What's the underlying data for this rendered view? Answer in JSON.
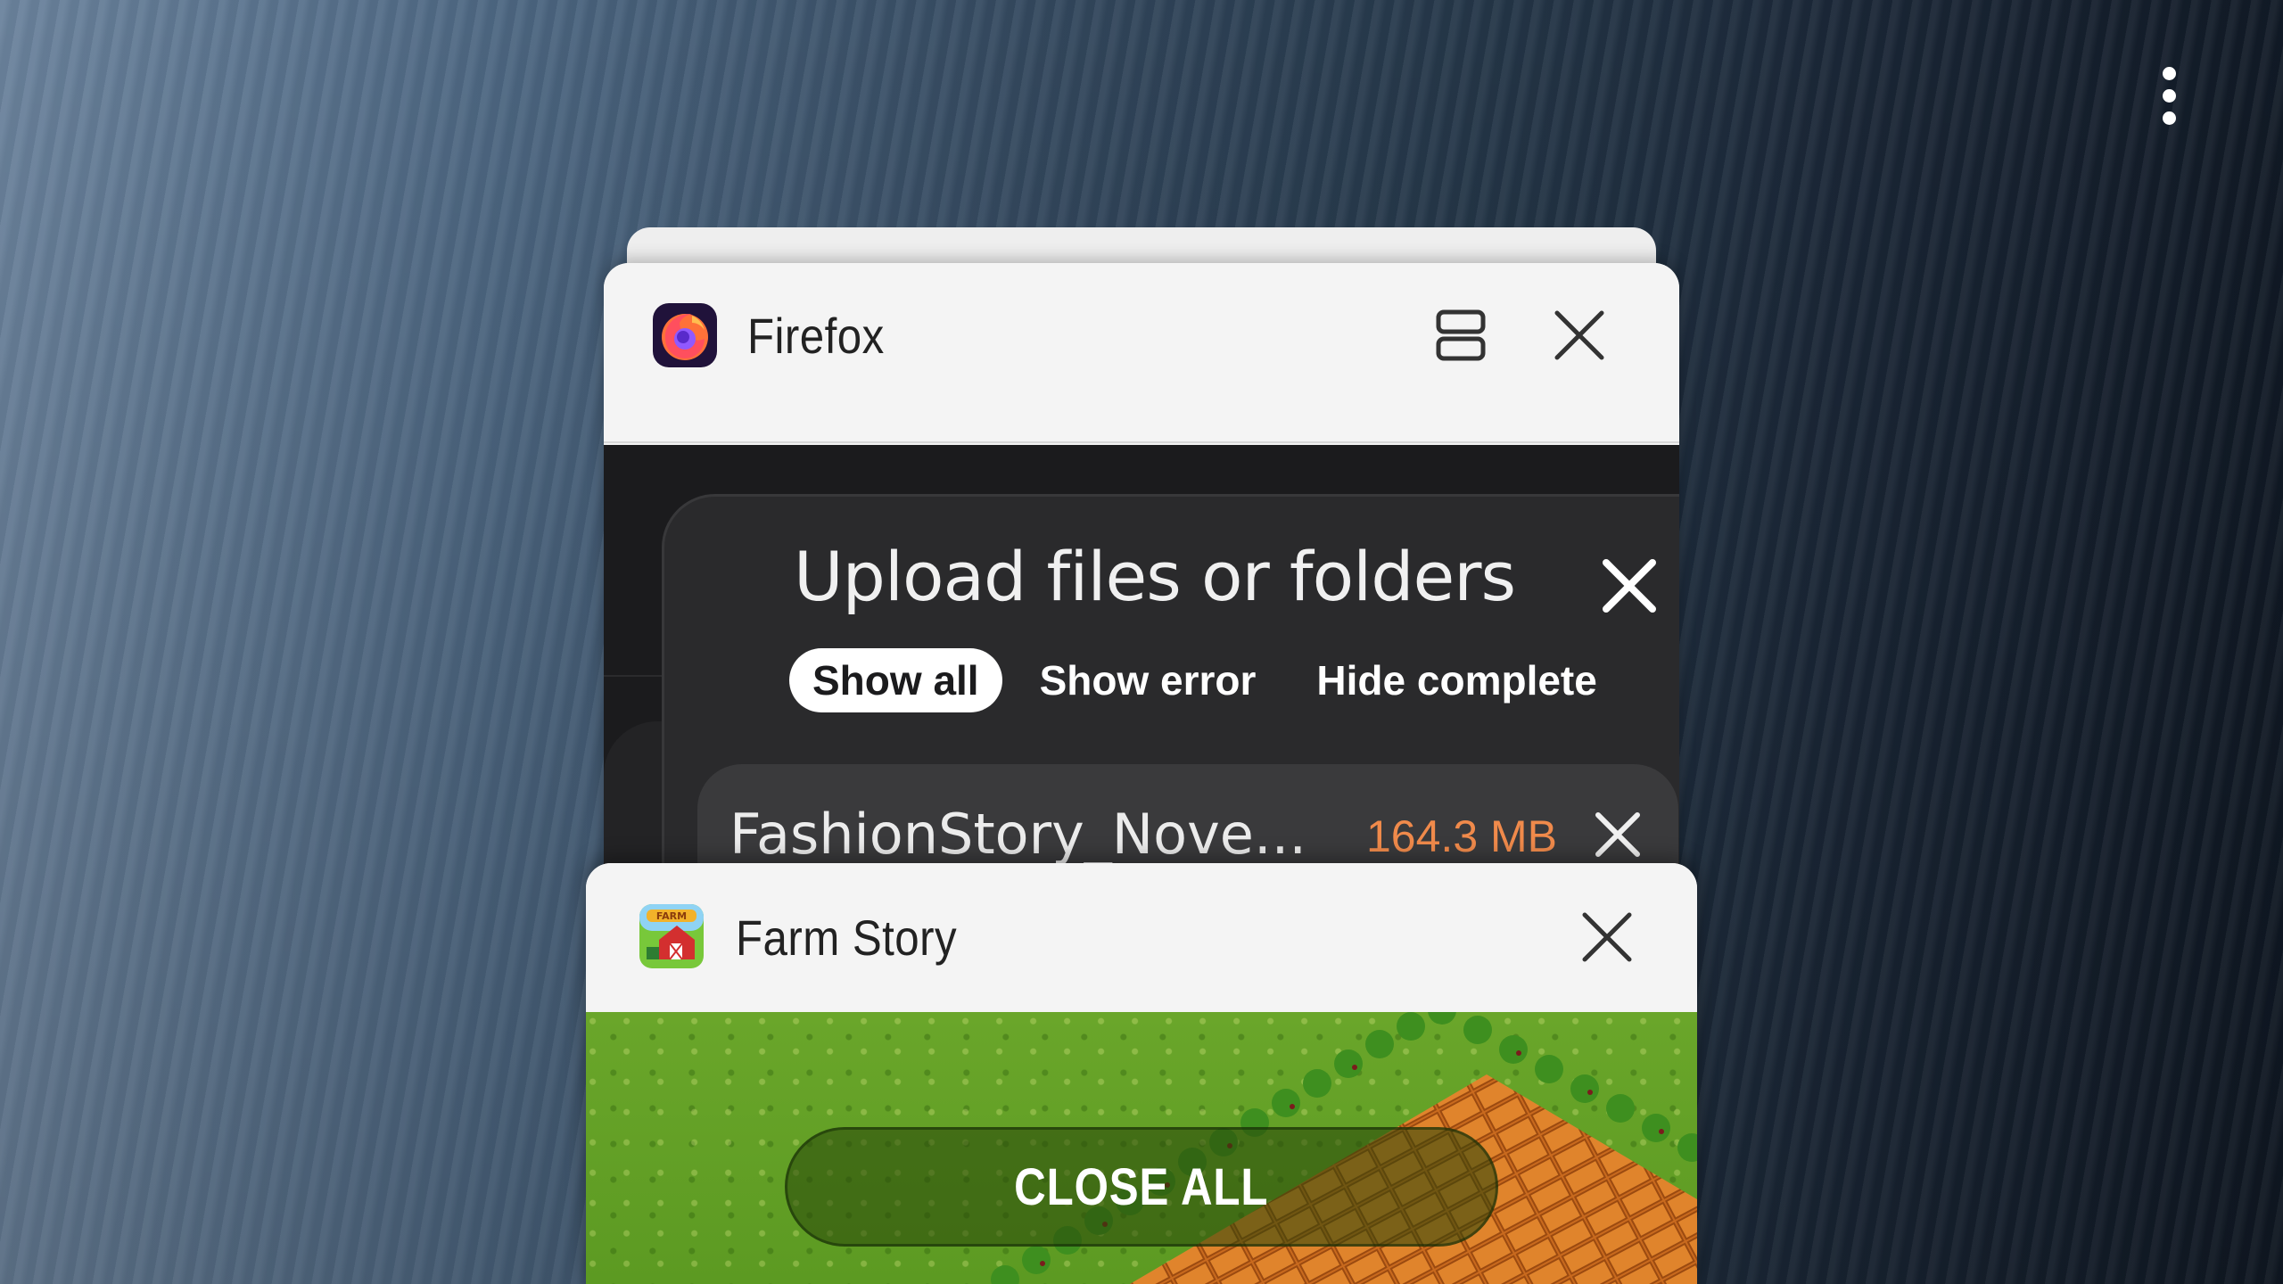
{
  "recents": {
    "menu_icon": "more-vertical-icon",
    "cards": [
      {
        "app_name": "Firefox",
        "icon": "firefox-icon",
        "actions": [
          "split-screen-icon",
          "close-icon"
        ],
        "content": {
          "panel_title": "Upload files or folders",
          "filters": [
            {
              "label": "Show all",
              "selected": true
            },
            {
              "label": "Show error",
              "selected": false
            },
            {
              "label": "Hide complete",
              "selected": false
            }
          ],
          "file": {
            "name": "FashionStory_Nove...",
            "size": "164.3 MB"
          }
        }
      },
      {
        "app_name": "Farm Story",
        "icon": "farm-story-icon",
        "actions": [
          "close-icon"
        ]
      }
    ],
    "close_all_label": "CLOSE ALL"
  },
  "colors": {
    "accent_size": "#f08a4b",
    "card_bg": "#f4f4f4",
    "firefox_bg": "#1b1b1d"
  }
}
